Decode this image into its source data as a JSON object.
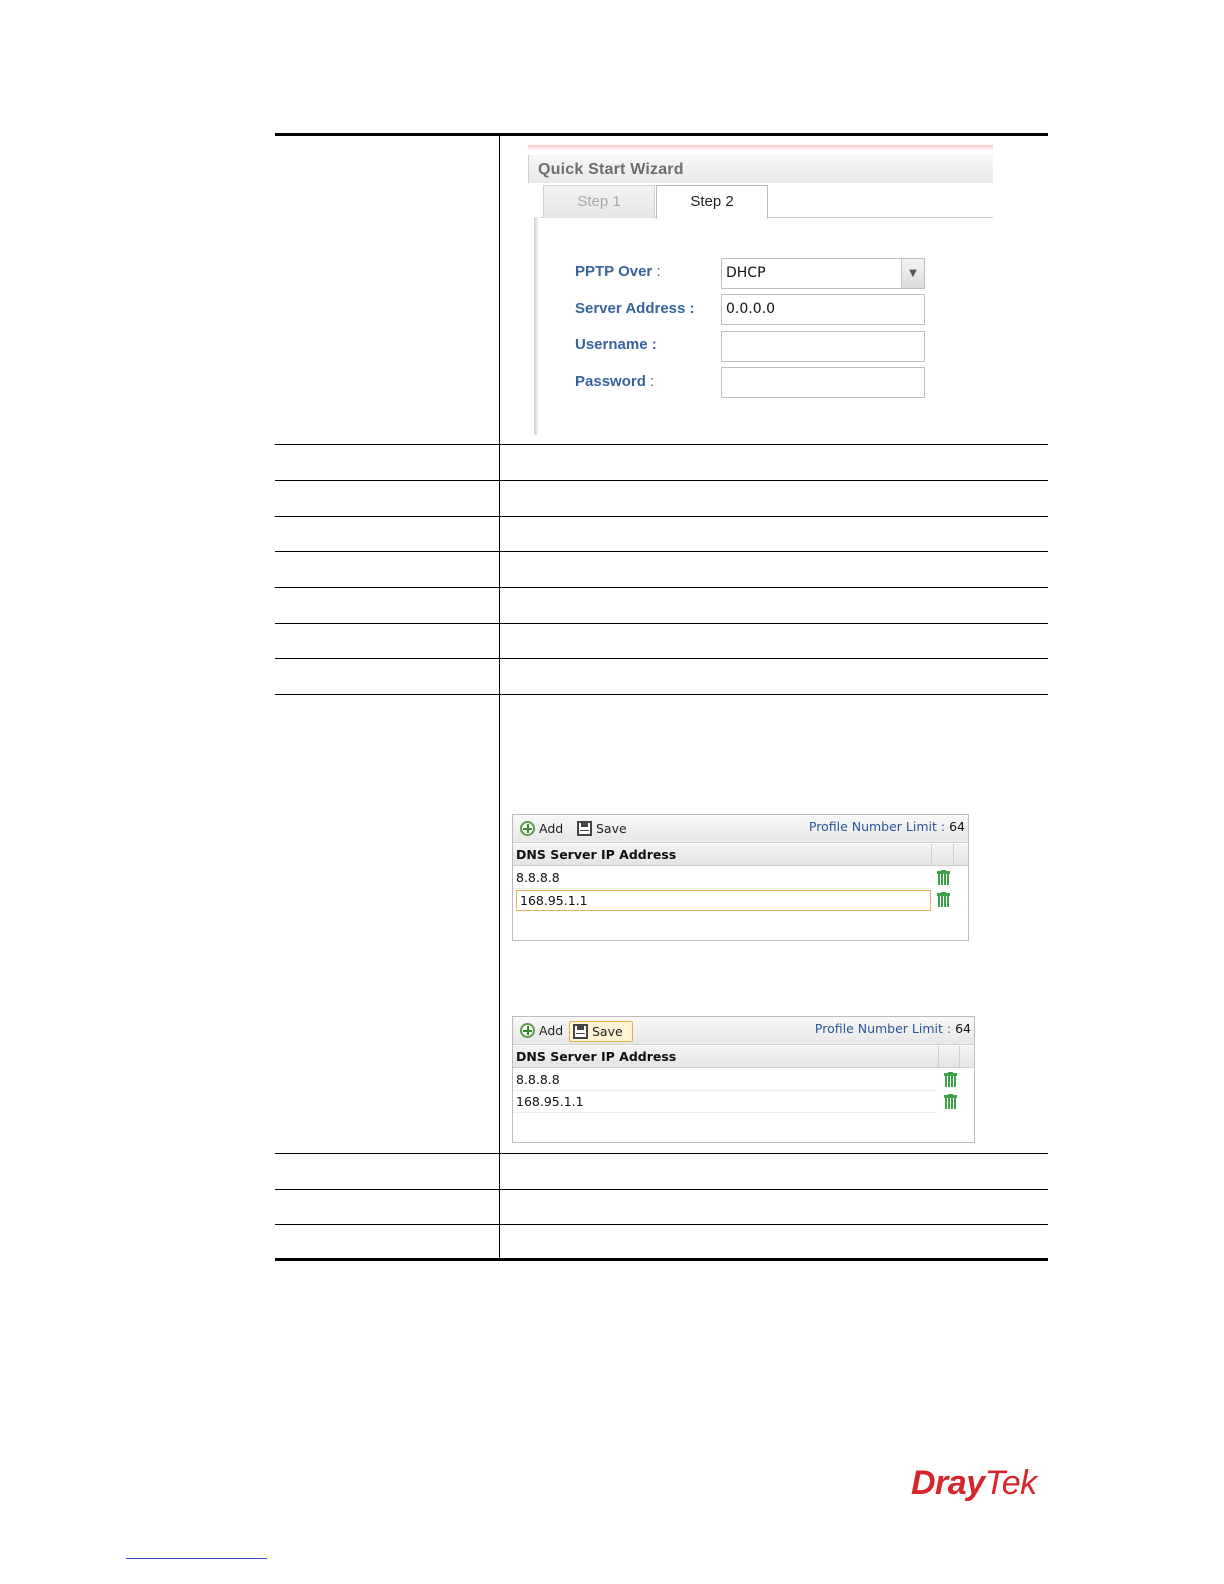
{
  "wizard": {
    "title": "Quick Start Wizard",
    "tabs": [
      {
        "label": "Step 1",
        "active": false
      },
      {
        "label": "Step 2",
        "active": true
      }
    ],
    "fields": [
      {
        "label": "PPTP Over",
        "value": "DHCP",
        "type": "select"
      },
      {
        "label": "Server Address",
        "value": "0.0.0.0",
        "type": "text"
      },
      {
        "label": "Username",
        "value": "",
        "type": "text"
      },
      {
        "label": "Password",
        "value": "",
        "type": "password"
      }
    ],
    "colon": ":"
  },
  "dns_panel_1": {
    "add_label": "Add",
    "save_label": "Save",
    "limit_label": "Profile Number Limit :",
    "limit_value": "64",
    "column_header": "DNS Server IP Address",
    "rows": [
      "8.8.8.8"
    ],
    "editing_value": "168.95.1.1"
  },
  "dns_panel_2": {
    "add_label": "Add",
    "save_label": "Save",
    "limit_label": "Profile Number Limit :",
    "limit_value": "64",
    "column_header": "DNS Server IP Address",
    "rows": [
      "8.8.8.8",
      "168.95.1.1"
    ]
  },
  "logo": {
    "part1": "Dray",
    "part2": "Tek",
    "color": "#d6262b"
  },
  "colors": {
    "label_blue": "#37659b",
    "limit_blue": "#2a5896",
    "trash_green": "#3fa14a",
    "focus_amber": "#e3b14c"
  }
}
